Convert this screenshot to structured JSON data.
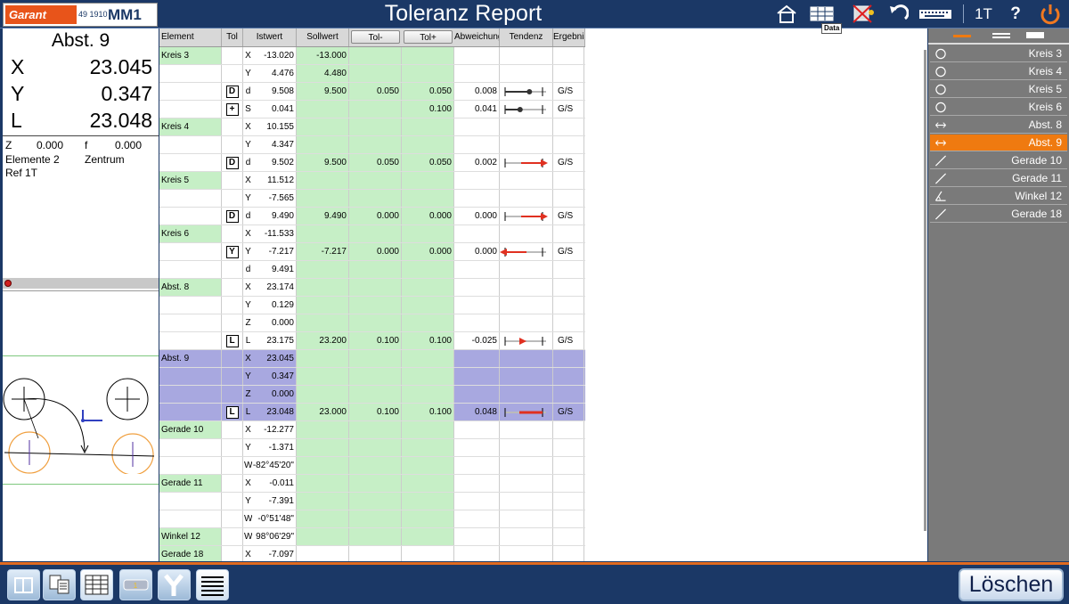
{
  "app": {
    "title": "Toleranz Report",
    "brand": "Garant",
    "model_number": "49 1910",
    "model_name": "MM1",
    "data_tooltip": "Data",
    "ref_mode": "1T",
    "help": "?"
  },
  "dro": {
    "title": "Abst. 9",
    "rows": [
      {
        "axis": "X",
        "value": "23.045"
      },
      {
        "axis": "Y",
        "value": "0.347"
      },
      {
        "axis": "L",
        "value": "23.048"
      }
    ],
    "z_label": "Z",
    "z_value": "0.000",
    "f_label": "f",
    "f_value": "0.000",
    "elements": "Elemente 2",
    "center": "Zentrum",
    "ref": "Ref 1T"
  },
  "table": {
    "headers": {
      "element": "Element",
      "tol": "Tol",
      "istwert": "Istwert",
      "sollwert": "Sollwert",
      "tol_minus": "Tol-",
      "tol_plus": "Tol+",
      "abweichung": "Abweichung",
      "tendenz": "Tendenz",
      "ergebnis": "Ergebnis"
    },
    "rows": [
      {
        "elem": "Kreis 3",
        "ax": "X",
        "ist": "-13.020",
        "soll": "-13.000"
      },
      {
        "elem": "",
        "ax": "Y",
        "ist": "4.476",
        "soll": "4.480"
      },
      {
        "elem": "",
        "tol": "D",
        "ax": "d",
        "ist": "9.508",
        "soll": "9.500",
        "tm": "0.050",
        "tp": "0.050",
        "abw": "0.008",
        "trend": "dot",
        "trend_pos": 0.65,
        "erg": "G/S"
      },
      {
        "elem": "",
        "tol": "+",
        "ax": "S",
        "ist": "0.041",
        "soll": "",
        "tm": "",
        "tp": "0.100",
        "abw": "0.041",
        "trend": "dot",
        "trend_pos": 0.4,
        "erg": "G/S"
      },
      {
        "elem": "Kreis 4",
        "ax": "X",
        "ist": "10.155"
      },
      {
        "elem": "",
        "ax": "Y",
        "ist": "4.347"
      },
      {
        "elem": "",
        "tol": "D",
        "ax": "d",
        "ist": "9.502",
        "soll": "9.500",
        "tm": "0.050",
        "tp": "0.050",
        "abw": "0.002",
        "trend": "arrow-right",
        "erg": "G/S"
      },
      {
        "elem": "Kreis 5",
        "ax": "X",
        "ist": "11.512"
      },
      {
        "elem": "",
        "ax": "Y",
        "ist": "-7.565"
      },
      {
        "elem": "",
        "tol": "D",
        "ax": "d",
        "ist": "9.490",
        "soll": "9.490",
        "tm": "0.000",
        "tp": "0.000",
        "abw": "0.000",
        "trend": "arrow-right",
        "erg": "G/S"
      },
      {
        "elem": "Kreis 6",
        "ax": "X",
        "ist": "-11.533"
      },
      {
        "elem": "",
        "tol": "Y",
        "ax": "Y",
        "ist": "-7.217",
        "soll": "-7.217",
        "tm": "0.000",
        "tp": "0.000",
        "abw": "0.000",
        "trend": "arrow-left",
        "erg": "G/S"
      },
      {
        "elem": "",
        "ax": "d",
        "ist": "9.491"
      },
      {
        "elem": "Abst. 8",
        "ax": "X",
        "ist": "23.174"
      },
      {
        "elem": "",
        "ax": "Y",
        "ist": "0.129"
      },
      {
        "elem": "",
        "ax": "Z",
        "ist": "0.000"
      },
      {
        "elem": "",
        "tol": "L",
        "ax": "L",
        "ist": "23.175",
        "soll": "23.200",
        "tm": "0.100",
        "tp": "0.100",
        "abw": "-0.025",
        "trend": "arrow-small",
        "erg": "G/S"
      },
      {
        "elem": "Abst. 9",
        "ax": "X",
        "ist": "23.045",
        "sel": true
      },
      {
        "elem": "",
        "ax": "Y",
        "ist": "0.347",
        "sel": true
      },
      {
        "elem": "",
        "ax": "Z",
        "ist": "0.000",
        "sel": true
      },
      {
        "elem": "",
        "tol": "L",
        "ax": "L",
        "ist": "23.048",
        "soll": "23.000",
        "tm": "0.100",
        "tp": "0.100",
        "abw": "0.048",
        "trend": "bar-right",
        "erg": "G/S",
        "sel": true
      },
      {
        "elem": "Gerade 10",
        "ax": "X",
        "ist": "-12.277"
      },
      {
        "elem": "",
        "ax": "Y",
        "ist": "-1.371"
      },
      {
        "elem": "",
        "ax": "W",
        "ist": "-82°45'20\""
      },
      {
        "elem": "Gerade 11",
        "ax": "X",
        "ist": "-0.011"
      },
      {
        "elem": "",
        "ax": "Y",
        "ist": "-7.391"
      },
      {
        "elem": "",
        "ax": "W",
        "ist": "-0°51'48\""
      },
      {
        "elem": "Winkel 12",
        "ax": "W",
        "ist": "98°06'29\""
      },
      {
        "elem": "Gerade 18",
        "ax": "X",
        "ist": "-7.097"
      }
    ]
  },
  "feature_list": [
    {
      "label": "Kreis 3",
      "icon": "circle-icon"
    },
    {
      "label": "Kreis 4",
      "icon": "circle-icon"
    },
    {
      "label": "Kreis 5",
      "icon": "circle-icon"
    },
    {
      "label": "Kreis 6",
      "icon": "circle-icon"
    },
    {
      "label": "Abst. 8",
      "icon": "distance-icon"
    },
    {
      "label": "Abst. 9",
      "icon": "distance-icon",
      "active": true
    },
    {
      "label": "Gerade 10",
      "icon": "line-icon"
    },
    {
      "label": "Gerade 11",
      "icon": "line-icon"
    },
    {
      "label": "Winkel 12",
      "icon": "angle-icon"
    },
    {
      "label": "Gerade 18",
      "icon": "line-icon"
    }
  ],
  "bottom": {
    "delete_label": "Löschen"
  },
  "colors": {
    "header_bg": "#1b3866",
    "accent_orange": "#ef7a10",
    "nominal_green": "#c6efc6",
    "selected_lavender": "#a8a8e0"
  }
}
